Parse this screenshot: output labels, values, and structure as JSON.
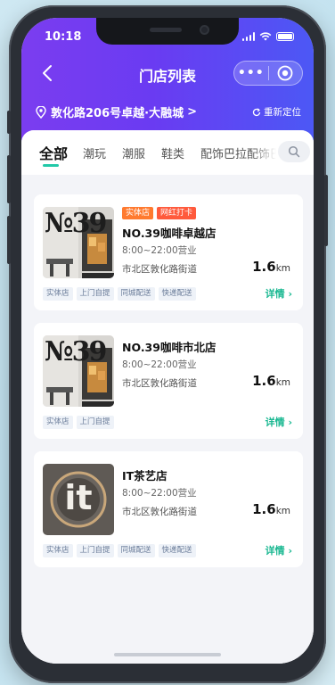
{
  "status_bar": {
    "time": "10:18"
  },
  "nav": {
    "title": "门店列表",
    "more_glyph": "•••"
  },
  "location": {
    "address": "敦化路206号卓越·大融城",
    "chevron": ">",
    "relocate_label": "重新定位"
  },
  "tabs": [
    {
      "label": "全部",
      "active": true
    },
    {
      "label": "潮玩",
      "active": false
    },
    {
      "label": "潮服",
      "active": false
    },
    {
      "label": "鞋类",
      "active": false
    },
    {
      "label": "配饰巴拉配饰巴",
      "active": false
    }
  ],
  "stores": [
    {
      "badges": [
        "实体店",
        "网红打卡"
      ],
      "name": "NO.39咖啡卓越店",
      "hours": "8:00~22:00营业",
      "address": "市北区敦化路街道",
      "distance_value": "1.6",
      "distance_unit": "km",
      "tags": [
        "实体店",
        "上门自提",
        "同城配送",
        "快递配送"
      ],
      "detail_label": "详情 ›",
      "thumb_text": "№39"
    },
    {
      "badges": [],
      "name": "NO.39咖啡市北店",
      "hours": "8:00~22:00营业",
      "address": "市北区敦化路街道",
      "distance_value": "1.6",
      "distance_unit": "km",
      "tags": [
        "实体店",
        "上门自提"
      ],
      "detail_label": "详情 ›",
      "thumb_text": "№39"
    },
    {
      "badges": [],
      "name": "IT茶艺店",
      "hours": "8:00~22:00营业",
      "address": "市北区敦化路街道",
      "distance_value": "1.6",
      "distance_unit": "km",
      "tags": [
        "实体店",
        "上门自提",
        "同城配送",
        "快递配送"
      ],
      "detail_label": "详情 ›",
      "thumb_text": "it"
    }
  ],
  "colors": {
    "header_start": "#7b3df0",
    "header_end": "#4c58f5",
    "accent": "#22c9a8",
    "link": "#1bb892",
    "badge_orange": "#ff7a2f",
    "badge_red": "#ff5a3c"
  }
}
